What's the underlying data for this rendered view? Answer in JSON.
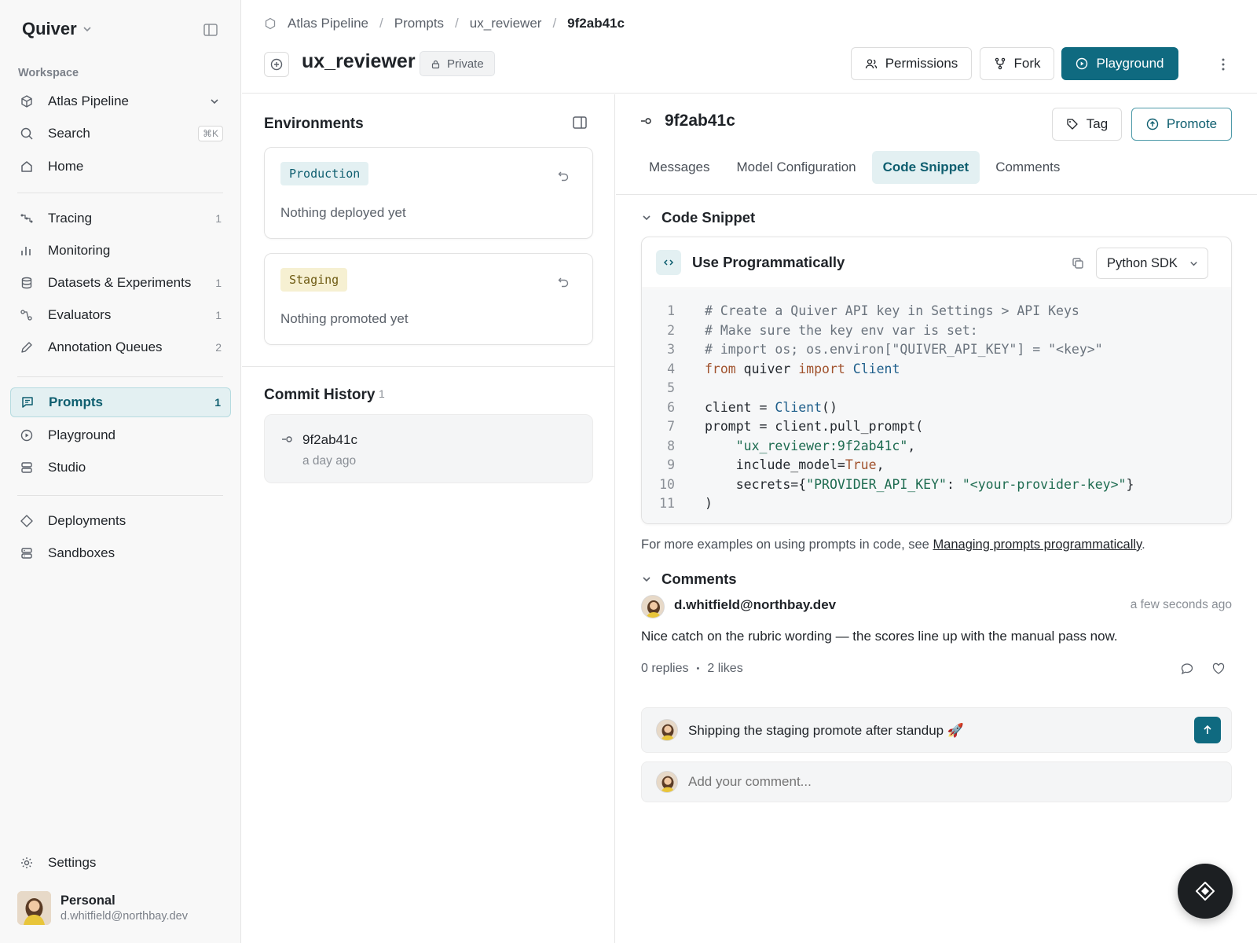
{
  "sidebar": {
    "brand": "Quiver",
    "section_label": "Workspace",
    "workspace": "Atlas Pipeline",
    "search_label": "Search",
    "search_shortcut": "⌘K",
    "home_label": "Home",
    "items": [
      {
        "label": "Tracing",
        "count": "1",
        "icon": "tracing-icon"
      },
      {
        "label": "Monitoring",
        "count": "",
        "icon": "bar-chart-icon"
      },
      {
        "label": "Datasets & Experiments",
        "count": "1",
        "icon": "database-icon"
      },
      {
        "label": "Evaluators",
        "count": "1",
        "icon": "evaluator-icon"
      },
      {
        "label": "Annotation Queues",
        "count": "2",
        "icon": "pencil-icon"
      },
      {
        "label": "Prompts",
        "count": "1",
        "icon": "message-icon",
        "active": true
      },
      {
        "label": "Playground",
        "count": "",
        "icon": "play-circle-icon"
      },
      {
        "label": "Studio",
        "count": "",
        "icon": "studio-icon"
      },
      {
        "label": "Deployments",
        "count": "",
        "icon": "diamond-icon"
      },
      {
        "label": "Sandboxes",
        "count": "",
        "icon": "server-icon"
      }
    ],
    "settings_label": "Settings",
    "profile": {
      "name": "Personal",
      "email": "d.whitfield@northbay.dev"
    }
  },
  "header": {
    "breadcrumb": [
      "Atlas Pipeline",
      "Prompts",
      "ux_reviewer",
      "9f2ab41c"
    ],
    "title": "ux_reviewer",
    "visibility": "Private",
    "buttons": {
      "permissions": "Permissions",
      "fork": "Fork",
      "playground": "Playground"
    }
  },
  "environments": {
    "title": "Environments",
    "cards": [
      {
        "tag": "Production",
        "status": "Nothing deployed yet"
      },
      {
        "tag": "Staging",
        "status": "Nothing promoted yet"
      }
    ]
  },
  "commit_history": {
    "title": "Commit History",
    "count": "1",
    "commits": [
      {
        "hash": "9f2ab41c",
        "time": "a day ago"
      }
    ]
  },
  "detail": {
    "commit_hash": "9f2ab41c",
    "tag_button": "Tag",
    "promote_button": "Promote",
    "tabs": [
      "Messages",
      "Model Configuration",
      "Code Snippet",
      "Comments"
    ],
    "active_tab": "Code Snippet",
    "code_section_title": "Code Snippet",
    "code_card_title": "Use Programmatically",
    "sdk_selected": "Python SDK",
    "code_lines": [
      "# Create a Quiver API key in Settings > API Keys",
      "# Make sure the key env var is set:",
      "# import os; os.environ[\"QUIVER_API_KEY\"] = \"<key>\"",
      "from quiver import Client",
      "",
      "client = Client()",
      "prompt = client.pull_prompt(",
      "    \"ux_reviewer:9f2ab41c\",",
      "    include_model=True,",
      "    secrets={\"PROVIDER_API_KEY\": \"<your-provider-key>\"}",
      ")"
    ],
    "more_text": "For more examples on using prompts in code, see ",
    "more_link": "Managing prompts programmatically",
    "more_end": ".",
    "comments_section_title": "Comments",
    "comment": {
      "author": "d.whitfield@northbay.dev",
      "time": "a few seconds ago",
      "body": "Nice catch on the rubric wording — the scores line up with the manual pass now.",
      "replies": "0 replies",
      "dot": "•",
      "likes": "2 likes"
    },
    "reply_draft": "Shipping the staging promote after standup 🚀",
    "comment_placeholder": "Add your comment..."
  },
  "colors": {
    "accent": "#0f6a80",
    "accent_soft": "#e3f0f2",
    "staging": "#f6f0d2"
  }
}
